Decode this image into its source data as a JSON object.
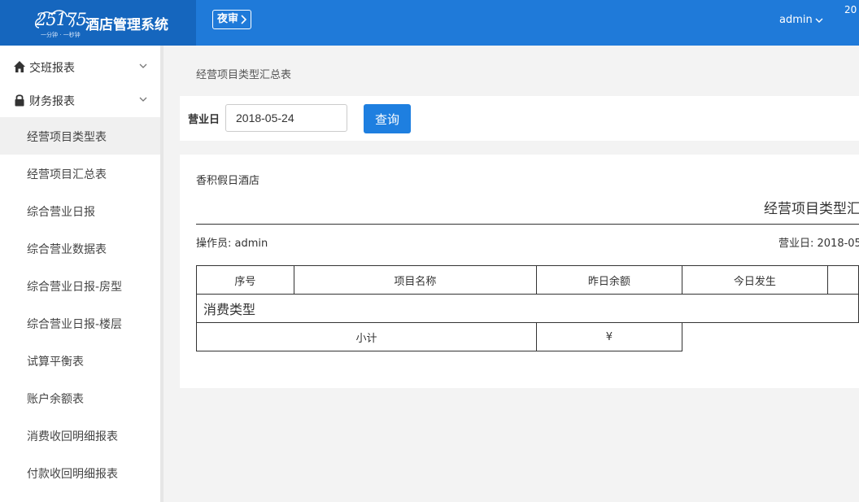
{
  "app": {
    "logo_text": "25175",
    "logo_tagline": "一分钟 · 一秒钟",
    "title": "酒店管理系统",
    "night_audit_label": "夜审",
    "user": "admin",
    "clock_text": "20"
  },
  "sidebar": {
    "groups": [
      {
        "label": "交班报表",
        "icon": "home-icon"
      },
      {
        "label": "财务报表",
        "icon": "lock-icon"
      }
    ],
    "items": [
      {
        "label": "经营项目类型表",
        "active": true
      },
      {
        "label": "经营项目汇总表"
      },
      {
        "label": "综合营业日报"
      },
      {
        "label": "综合营业数据表"
      },
      {
        "label": "综合营业日报-房型"
      },
      {
        "label": "综合营业日报-楼层"
      },
      {
        "label": "试算平衡表"
      },
      {
        "label": "账户余额表"
      },
      {
        "label": "消费收回明细报表"
      },
      {
        "label": "付款收回明细报表"
      }
    ]
  },
  "main": {
    "breadcrumb": "经营项目类型汇总表",
    "filter": {
      "label": "营业日",
      "date_value": "2018-05-24",
      "query_label": "查询"
    },
    "report": {
      "hotel_name": "香积假日酒店",
      "title": "经营项目类型汇",
      "operator": "操作员: admin",
      "business_date": "营业日: 2018-05",
      "columns": [
        "序号",
        "项目名称",
        "昨日余额",
        "今日发生"
      ],
      "section_label": "消费类型",
      "subtotal_label": "小计",
      "subtotal_value": "¥"
    }
  },
  "colors": {
    "topbar": "#1f7ad9",
    "logo_block": "#1566be",
    "primary_button": "#1e7fe0"
  }
}
